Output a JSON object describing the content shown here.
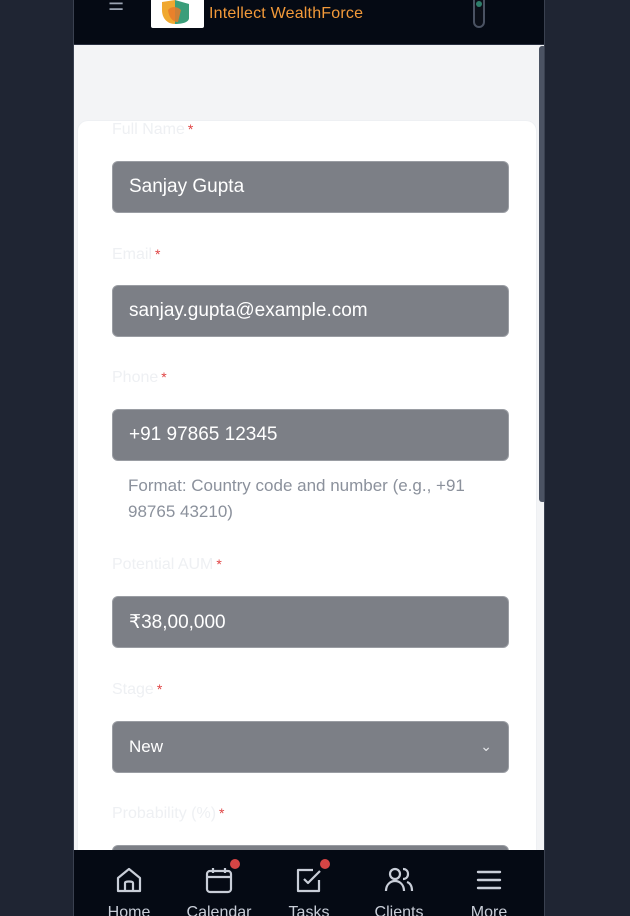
{
  "header": {
    "brand": "Intellect WealthForce",
    "menu_icon": "hamburger-icon"
  },
  "form": {
    "full_name": {
      "label": "Full Name",
      "required": "*",
      "value": "Sanjay Gupta"
    },
    "email": {
      "label": "Email",
      "required": "*",
      "value": "sanjay.gupta@example.com"
    },
    "phone": {
      "label": "Phone",
      "required": "*",
      "value": "+91 97865 12345",
      "hint": "Format: Country code and number (e.g., +91 98765 43210)"
    },
    "aum": {
      "label": "Potential AUM",
      "required": "*",
      "value": "₹38,00,000"
    },
    "stage": {
      "label": "Stage",
      "required": "*",
      "value": "New"
    },
    "probability": {
      "label": "Probability (%)",
      "required": "*"
    }
  },
  "nav": {
    "items": [
      {
        "label": "Home",
        "icon": "home-icon",
        "badge": false
      },
      {
        "label": "Calendar",
        "icon": "calendar-icon",
        "badge": true
      },
      {
        "label": "Tasks",
        "icon": "tasks-icon",
        "badge": true
      },
      {
        "label": "Clients",
        "icon": "clients-icon",
        "badge": false
      },
      {
        "label": "More",
        "icon": "menu-icon",
        "badge": false
      }
    ]
  },
  "colors": {
    "brand": "#f39a3a",
    "badge": "#d64545",
    "required": "#e04444"
  }
}
